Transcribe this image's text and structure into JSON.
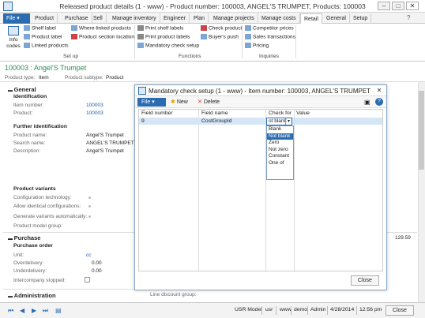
{
  "window": {
    "title": "Released product details (1 - www) - Product number: 100003, ANGEL'S TRUMPET, Products: 100003",
    "minimize": "–",
    "maximize": "□",
    "close": "✕"
  },
  "tabs": [
    "File",
    "Product",
    "Purchase",
    "Sell",
    "Manage inventory",
    "Engineer",
    "Plan",
    "Manage projects",
    "Manage costs",
    "Retail",
    "General",
    "Setup"
  ],
  "ribbon": {
    "info_codes": "Info codes",
    "shelf_label": "Shelf label",
    "product_label": "Product label",
    "linked_products": "Linked products",
    "where_linked_products": "Where-linked products",
    "product_section_location": "Product section location",
    "group_setup": "Set up",
    "print_shelf_labels": "Print shelf labels",
    "print_product_labels": "Print product labels",
    "mandatory_check_setup": "Mandatory check setup",
    "check_product": "Check product",
    "buyers_push": "Buyer's push",
    "group_functions": "Functions",
    "competitor_prices": "Competitor prices",
    "sales_transactions": "Sales transactions",
    "pricing": "Pricing",
    "group_inquiries": "Inquiries"
  },
  "record": {
    "title": "100003 : Angel'S Trumpet",
    "product_type_label": "Product type:",
    "product_type_value": "Item",
    "product_subtype_label": "Product subtype:",
    "product_subtype_value": "Product"
  },
  "general": {
    "header": "General",
    "identification": "Identification",
    "item_number_label": "Item number:",
    "item_number": "100003",
    "product_label": "Product:",
    "product": "100003",
    "further_identification": "Further identification",
    "product_name_label": "Product name:",
    "product_name": "Angel'S Trumpet",
    "search_name_label": "Search name:",
    "search_name": "ANGEL'S TRUMPET",
    "description_label": "Description:",
    "description": "Angel'S Trumpet",
    "product_variants": "Product variants",
    "config_tech_label": "Configuration technology:",
    "allow_identical_label": "Allow identical configurations:",
    "generate_variants_label": "Generate variants automatically:",
    "product_model_group_label": "Product model group:"
  },
  "purchase": {
    "header": "Purchase",
    "purchase_order": "Purchase order",
    "unit_label": "Unit:",
    "unit": "cc",
    "overdelivery_label": "Overdelivery:",
    "overdelivery": "0.00",
    "underdelivery_label": "Underdelivery:",
    "underdelivery": "0.00",
    "intercompany_stopped_label": "Intercompany stopped:",
    "price_value": "129.59",
    "line_discount_group_label": "Line discount group:"
  },
  "administration": {
    "header": "Administration"
  },
  "statusbar": {
    "model": "USR Model",
    "layer": "usr",
    "account": "www",
    "partition": "demo",
    "user": "Admin",
    "date": "4/28/2014",
    "time": "12:56 pm",
    "close": "Close"
  },
  "dialog": {
    "title": "Mandatory check setup (1 - www) - Item number: 100003, ANGEL'S TRUMPET",
    "file": "File",
    "new": "New",
    "delete": "Delete",
    "columns": [
      "Field number",
      "Field name",
      "Check for",
      "Value"
    ],
    "row": {
      "field_number": "9",
      "field_name": "CostGroupId",
      "check_for": "ot blank",
      "value": ""
    },
    "options": [
      "Blank",
      "Not blank",
      "Zero",
      "Not zero",
      "Constant",
      "One of"
    ],
    "selected_option": "Not blank",
    "close": "Close"
  },
  "colors": {
    "accent": "#2b6cb0",
    "record_title": "#2e8b57",
    "selected_row": "#d5e6f7"
  }
}
